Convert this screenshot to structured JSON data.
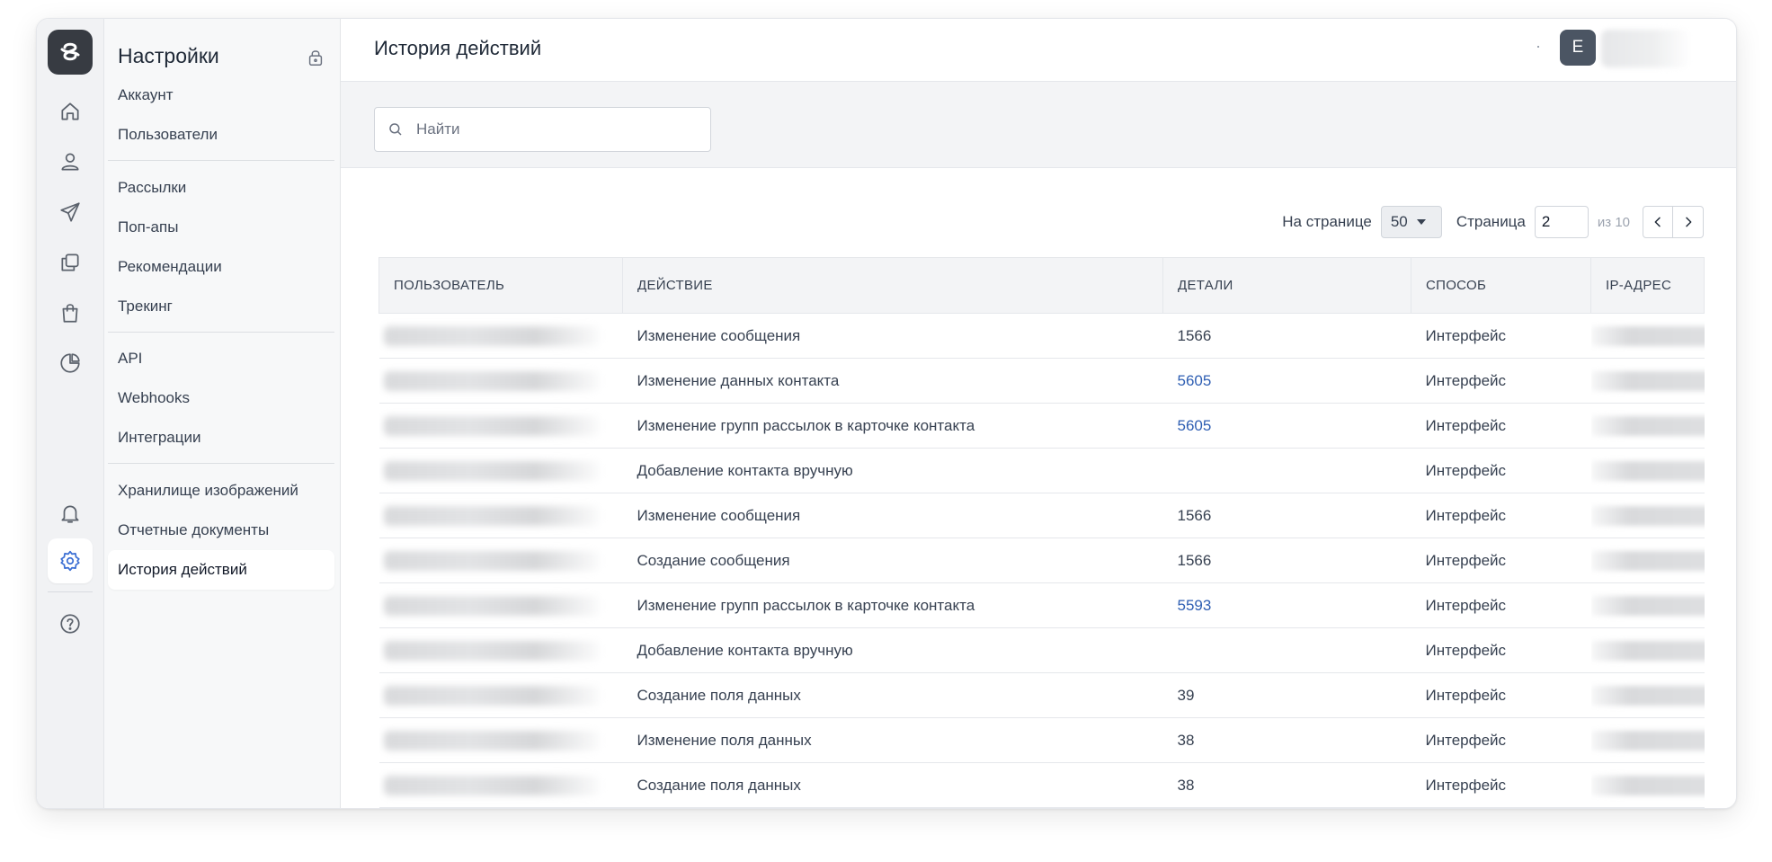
{
  "rail": {
    "icons": [
      "home-icon",
      "user-icon",
      "send-icon",
      "copy-icon",
      "shopping-bag-icon",
      "pie-chart-icon",
      "bell-icon",
      "settings-icon",
      "help-icon"
    ],
    "active": "settings-icon"
  },
  "settings": {
    "title": "Настройки",
    "groups": [
      [
        "Аккаунт",
        "Пользователи"
      ],
      [
        "Рассылки",
        "Поп-апы",
        "Рекомендации",
        "Трекинг"
      ],
      [
        "API",
        "Webhooks",
        "Интеграции"
      ],
      [
        "Хранилище изображений",
        "Отчетные документы",
        "История действий"
      ]
    ],
    "active": "История действий"
  },
  "header": {
    "title": "История действий",
    "avatar_letter": "E"
  },
  "search": {
    "placeholder": "Найти"
  },
  "pager": {
    "per_page_label": "На странице",
    "per_page_value": "50",
    "page_label": "Страница",
    "page_value": "2",
    "of_total": "из 10"
  },
  "table": {
    "columns": [
      "ПОЛЬЗОВАТЕЛЬ",
      "ДЕЙСТВИЕ",
      "ДЕТАЛИ",
      "СПОСОБ",
      "IP-АДРЕС"
    ],
    "rows": [
      {
        "action": "Изменение сообщения",
        "details": "1566",
        "details_link": false,
        "method": "Интерфейс"
      },
      {
        "action": "Изменение данных контакта",
        "details": "5605",
        "details_link": true,
        "method": "Интерфейс"
      },
      {
        "action": "Изменение групп рассылок в карточке контакта",
        "details": "5605",
        "details_link": true,
        "method": "Интерфейс"
      },
      {
        "action": "Добавление контакта вручную",
        "details": "",
        "details_link": false,
        "method": "Интерфейс"
      },
      {
        "action": "Изменение сообщения",
        "details": "1566",
        "details_link": false,
        "method": "Интерфейс"
      },
      {
        "action": "Создание сообщения",
        "details": "1566",
        "details_link": false,
        "method": "Интерфейс"
      },
      {
        "action": "Изменение групп рассылок в карточке контакта",
        "details": "5593",
        "details_link": true,
        "method": "Интерфейс"
      },
      {
        "action": "Добавление контакта вручную",
        "details": "",
        "details_link": false,
        "method": "Интерфейс"
      },
      {
        "action": "Создание поля данных",
        "details": "39",
        "details_link": false,
        "method": "Интерфейс"
      },
      {
        "action": "Изменение поля данных",
        "details": "38",
        "details_link": false,
        "method": "Интерфейс"
      },
      {
        "action": "Создание поля данных",
        "details": "38",
        "details_link": false,
        "method": "Интерфейс"
      }
    ]
  },
  "colors": {
    "accent": "#3b6fd4",
    "link": "#2f5fb3",
    "logo_bg": "#373b42"
  }
}
